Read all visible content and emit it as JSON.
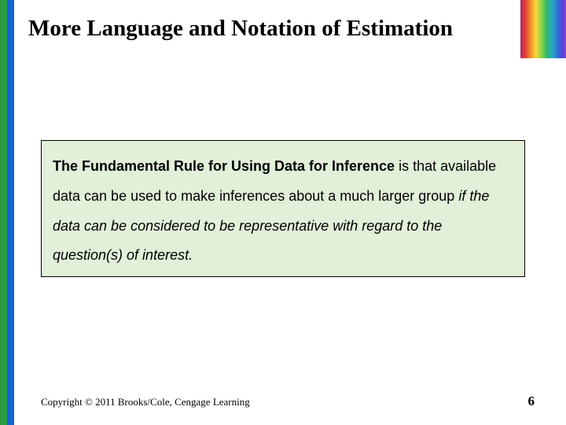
{
  "title": "More Language and Notation of Estimation",
  "box": {
    "part1_bold": "The Fundamental Rule for Using Data for Inference",
    "part2_plain": " is that available data can be used to make inferences about a much larger group ",
    "part3_italic": "if the data can be considered to be representative with regard to the question(s) of interest."
  },
  "footer": {
    "copyright": "Copyright © 2011 Brooks/Cole, Cengage Learning",
    "page_number": "6"
  }
}
